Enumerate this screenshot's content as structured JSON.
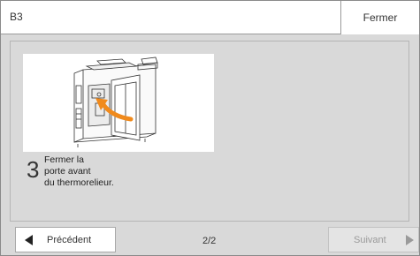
{
  "header": {
    "title": "B3",
    "close_label": "Fermer"
  },
  "step": {
    "number": "3",
    "lines": [
      "Fermer la",
      "porte avant",
      "du thermorelieur."
    ]
  },
  "footer": {
    "prev_label": "Précédent",
    "page_indicator": "2/2",
    "next_label": "Suivant"
  },
  "colors": {
    "accent_arrow": "#f08a1c",
    "panel_background": "#d9d9d9"
  }
}
